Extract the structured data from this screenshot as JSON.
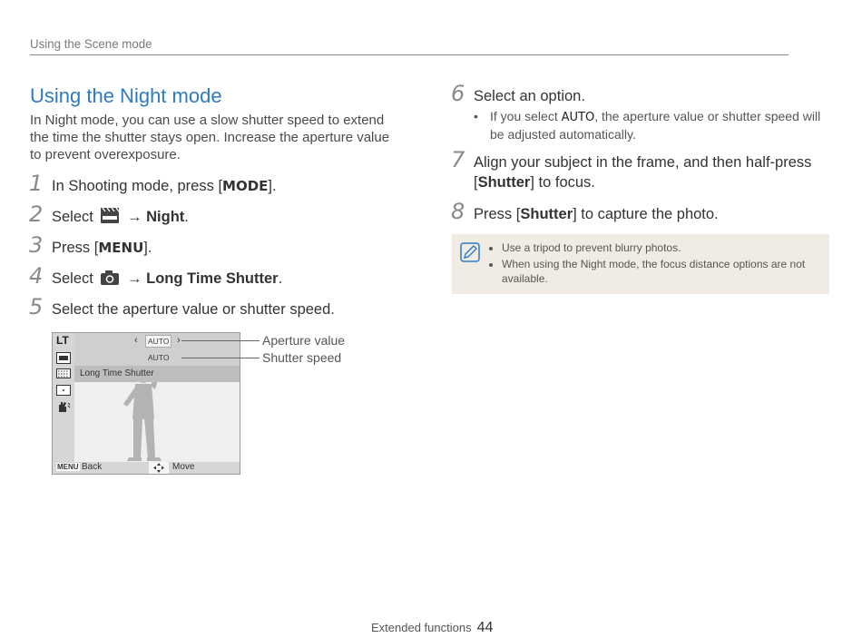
{
  "header": "Using the Scene mode",
  "title": "Using the Night mode",
  "intro": "In Night mode, you can use a slow shutter speed to extend the time the shutter stays open. Increase the aperture value to prevent overexposure.",
  "steps": {
    "s1": {
      "num": "1",
      "pre": "In Shooting mode, press [",
      "key": "MODE",
      "post": "]."
    },
    "s2": {
      "num": "2",
      "pre": "Select",
      "arrow": "→",
      "target": "Night",
      "post": "."
    },
    "s3": {
      "num": "3",
      "pre": "Press [",
      "key": "MENU",
      "post": "]."
    },
    "s4": {
      "num": "4",
      "pre": "Select",
      "arrow": "→",
      "target": "Long Time Shutter",
      "post": "."
    },
    "s5": {
      "num": "5",
      "text": "Select the aperture value or shutter speed."
    },
    "s6": {
      "num": "6",
      "text": "Select an option.",
      "sub_pre": "If you select ",
      "sub_key": "AUTO",
      "sub_post": ", the aperture value or shutter speed will be adjusted automatically."
    },
    "s7": {
      "num": "7",
      "line1": "Align your subject in the frame, and then half-press",
      "pre": "[",
      "key": "Shutter",
      "post": "] to focus."
    },
    "s8": {
      "num": "8",
      "pre": "Press [",
      "key": "Shutter",
      "post": "] to capture the photo."
    }
  },
  "note": {
    "items": [
      "Use a tripod to prevent blurry photos.",
      "When using the Night mode, the focus distance options are not available."
    ]
  },
  "screen": {
    "lt": "LT",
    "val1": "AUTO",
    "val2": "AUTO",
    "label": "Long Time Shutter",
    "menu": "MENU",
    "back": "Back",
    "move": "Move",
    "chev_left": "‹",
    "chev_right": "›"
  },
  "callouts": {
    "aperture": "Aperture value",
    "shutter": "Shutter speed"
  },
  "bullet": "•",
  "footer": {
    "section": "Extended functions",
    "page": "44"
  },
  "colors": {
    "title": "#2e7bc4",
    "note_bg": "#f1ece3"
  }
}
